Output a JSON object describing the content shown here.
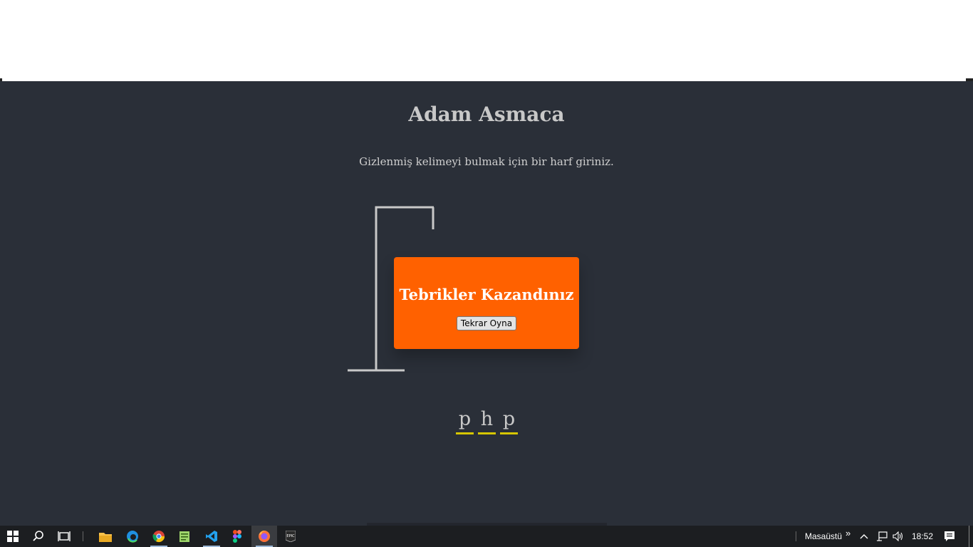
{
  "game": {
    "title": "Adam Asmaca",
    "instruction": "Gizlenmiş kelimeyi bulmak için bir harf giriniz.",
    "popup": {
      "message": "Tebrikler Kazandınız",
      "button_label": "Tekrar Oyna"
    },
    "word_letters": [
      "p",
      "h",
      "p"
    ]
  },
  "taskbar": {
    "icons": [
      "windows-start-icon",
      "search-icon",
      "task-view-icon",
      "file-explorer-icon",
      "edge-icon",
      "chrome-icon",
      "notepad-icon",
      "vscode-icon",
      "figma-icon",
      "firefox-icon",
      "epic-games-icon"
    ],
    "toolbar_label": "Masaüstü",
    "time": "18:52"
  },
  "colors": {
    "background": "#2a2f38",
    "popup": "#ff6100",
    "underline": "#d6c600"
  }
}
